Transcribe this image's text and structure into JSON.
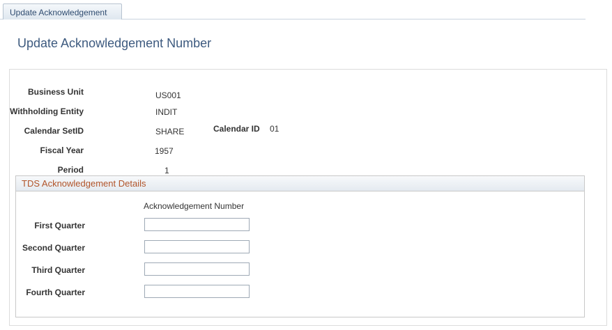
{
  "tab": {
    "label": "Update Acknowledgement"
  },
  "page": {
    "title": "Update Acknowledgement Number"
  },
  "fields": {
    "business_unit": {
      "label": "Business Unit",
      "value": "US001"
    },
    "withholding_entity": {
      "label": "Withholding Entity",
      "value": "INDIT"
    },
    "calendar_setid": {
      "label": "Calendar SetID",
      "value": "SHARE"
    },
    "calendar_id": {
      "label": "Calendar ID",
      "value": "01"
    },
    "fiscal_year": {
      "label": "Fiscal Year",
      "value": "1957"
    },
    "period": {
      "label": "Period",
      "value": "1"
    }
  },
  "section": {
    "title": "TDS Acknowledgement Details",
    "column_header": "Acknowledgement Number",
    "quarters": [
      {
        "label": "First Quarter",
        "value": ""
      },
      {
        "label": "Second Quarter",
        "value": ""
      },
      {
        "label": "Third Quarter",
        "value": ""
      },
      {
        "label": "Fourth Quarter",
        "value": ""
      }
    ]
  },
  "colors": {
    "title": "#3d5a7f",
    "section_title": "#b1542a",
    "tab_text": "#2f4c70"
  }
}
